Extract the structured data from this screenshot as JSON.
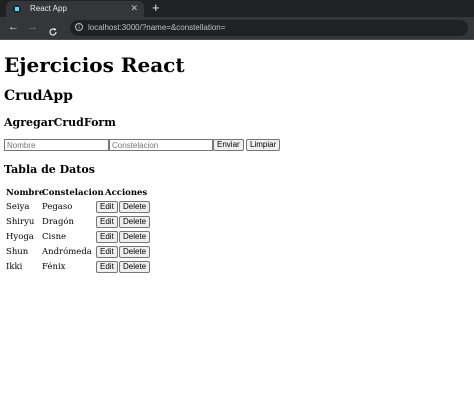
{
  "browser": {
    "tab_title": "React App",
    "tab_close": "✕",
    "new_tab": "+",
    "back": "←",
    "forward": "→",
    "reload": "C",
    "url": "localhost:3000/?name=&constellation="
  },
  "page": {
    "title": "Ejercicios React",
    "app_title": "CrudApp",
    "form_title": "AgregarCrudForm",
    "table_title": "Tabla de Datos"
  },
  "form": {
    "name_placeholder": "Nombre",
    "constellation_placeholder": "Constelacion",
    "submit_label": "Enviar",
    "reset_label": "Limpiar"
  },
  "table": {
    "headers": [
      "Nombre",
      "Constelacion",
      "Acciones"
    ],
    "edit_label": "Edit",
    "delete_label": "Delete",
    "rows": [
      {
        "name": "Seiya",
        "constellation": "Pegaso"
      },
      {
        "name": "Shiryu",
        "constellation": "Dragón"
      },
      {
        "name": "Hyoga",
        "constellation": "Cisne"
      },
      {
        "name": "Shun",
        "constellation": "Andrómeda"
      },
      {
        "name": "Ikki",
        "constellation": "Fénix"
      }
    ]
  }
}
